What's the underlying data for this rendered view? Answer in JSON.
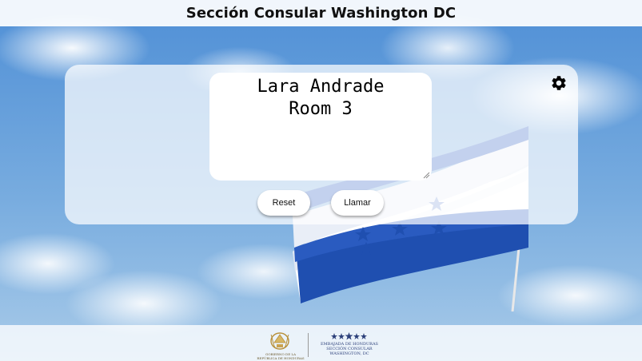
{
  "header": {
    "title": "Sección Consular Washington DC"
  },
  "display": {
    "line1": "Lara Andrade",
    "line2": "Room 3"
  },
  "buttons": {
    "reset": "Reset",
    "call": "Llamar"
  },
  "settings": {
    "icon": "gear-icon"
  },
  "footer": {
    "gov_text_line1": "GOBIERNO DE LA",
    "gov_text_line2": "REPÚBLICA DE HONDURAS",
    "embassy_line1": "EMBAJADA DE HONDURAS",
    "embassy_line2": "SECCIÓN CONSULAR",
    "embassy_line3": "WASHINGTON, DC"
  },
  "colors": {
    "flag_blue": "#1f4fb0",
    "flag_white": "#ffffff",
    "sky": "#5f97d6",
    "gold": "#b8903a"
  }
}
